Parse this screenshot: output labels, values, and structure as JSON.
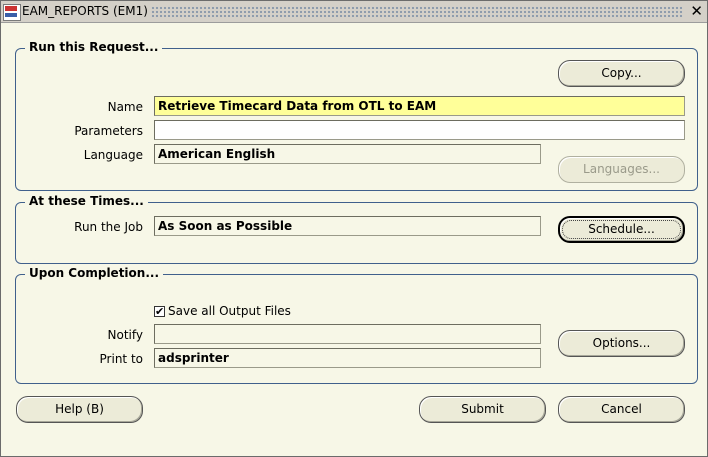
{
  "window": {
    "title": "EAM_REPORTS (EM1)",
    "close_glyph": "✕"
  },
  "run_request": {
    "legend": "Run this Request...",
    "copy_button": "Copy...",
    "name_label": "Name",
    "name_value": "Retrieve Timecard Data from OTL to EAM",
    "parameters_label": "Parameters",
    "parameters_value": "",
    "language_label": "Language",
    "language_value": "American English",
    "languages_button": "Languages..."
  },
  "times": {
    "legend": "At these Times...",
    "run_job_label": "Run the Job",
    "run_job_value": "As Soon as Possible",
    "schedule_button": "Schedule..."
  },
  "completion": {
    "legend": "Upon Completion...",
    "save_output_label": "Save all Output Files",
    "save_output_checked": true,
    "notify_label": "Notify",
    "notify_value": "",
    "print_to_label": "Print to",
    "print_to_value": "adsprinter",
    "options_button": "Options..."
  },
  "footer": {
    "help_button": "Help (B)",
    "submit_button": "Submit",
    "cancel_button": "Cancel"
  },
  "colors": {
    "required_field": "#ffff99",
    "background": "#f7f7e7",
    "group_border": "#40608c"
  }
}
